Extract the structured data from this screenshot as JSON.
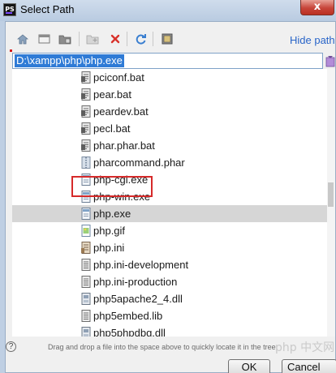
{
  "window": {
    "app_icon_text": "PS",
    "title": "Select Path",
    "close_glyph": "x"
  },
  "toolbar": {
    "buttons": [
      {
        "name": "home-icon",
        "interactable": true
      },
      {
        "name": "desktop-icon",
        "interactable": true
      },
      {
        "name": "project-folder-icon",
        "interactable": true
      },
      {
        "name": "new-folder-icon",
        "interactable": false
      },
      {
        "name": "delete-icon",
        "interactable": true
      },
      {
        "name": "refresh-icon",
        "interactable": true
      },
      {
        "name": "show-hidden-icon",
        "interactable": true
      }
    ],
    "hide_path_label": "Hide path"
  },
  "path": {
    "value": "D:\\xampp\\php\\php.exe"
  },
  "tree": {
    "items": [
      {
        "label": "pciconf.bat",
        "icon": "script-file-icon"
      },
      {
        "label": "pear.bat",
        "icon": "script-file-icon"
      },
      {
        "label": "peardev.bat",
        "icon": "script-file-icon"
      },
      {
        "label": "pecl.bat",
        "icon": "script-file-icon"
      },
      {
        "label": "phar.phar.bat",
        "icon": "script-file-icon"
      },
      {
        "label": "pharcommand.phar",
        "icon": "archive-file-icon"
      },
      {
        "label": "php-cgi.exe",
        "icon": "executable-file-icon"
      },
      {
        "label": "php-win.exe",
        "icon": "executable-file-icon"
      },
      {
        "label": "php.exe",
        "icon": "executable-file-icon",
        "selected": true
      },
      {
        "label": "php.gif",
        "icon": "image-file-icon"
      },
      {
        "label": "php.ini",
        "icon": "config-file-icon"
      },
      {
        "label": "php.ini-development",
        "icon": "text-file-icon"
      },
      {
        "label": "php.ini-production",
        "icon": "text-file-icon"
      },
      {
        "label": "php5apache2_4.dll",
        "icon": "library-file-icon"
      },
      {
        "label": "php5embed.lib",
        "icon": "text-file-icon"
      },
      {
        "label": "php5phpdbg.dll",
        "icon": "library-file-icon"
      }
    ]
  },
  "footer": {
    "help_glyph": "?",
    "hint": "Drag and drop a file into the space above to quickly locate it in the tree",
    "watermark": "php 中文网",
    "ok_label": "OK",
    "cancel_label": "Cancel"
  },
  "colors": {
    "selection": "#2f7bd6",
    "highlight_box": "#d62a2a",
    "link": "#2864c8"
  }
}
